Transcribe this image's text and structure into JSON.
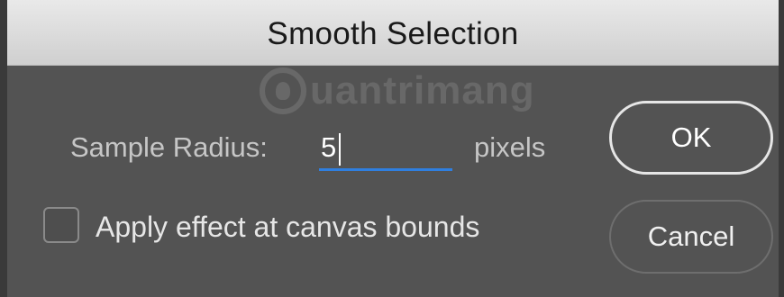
{
  "dialog": {
    "title": "Smooth Selection",
    "watermark": "uantrimang"
  },
  "form": {
    "sample_radius_label": "Sample Radius:",
    "sample_radius_value": "5",
    "units_label": "pixels",
    "apply_effect_label": "Apply effect at canvas bounds",
    "apply_effect_checked": false
  },
  "buttons": {
    "ok_label": "OK",
    "cancel_label": "Cancel"
  },
  "colors": {
    "background": "#535353",
    "titlebar": "#dcdcdc",
    "focus_underline": "#2f7fe0"
  }
}
